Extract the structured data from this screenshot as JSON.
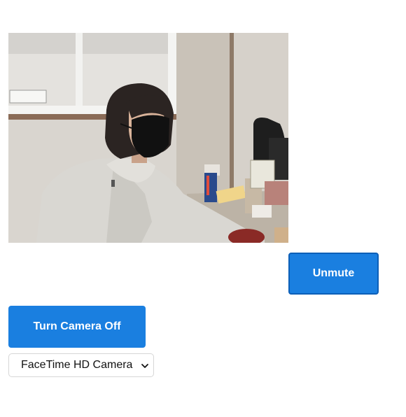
{
  "video": {
    "icon": "camera-feed-image",
    "description_colors": {
      "wall": "#cfcac2",
      "hoodie": "#d9d7d2",
      "hair": "#2b2422",
      "mask": "#111111"
    }
  },
  "controls": {
    "unmute_label": "Unmute",
    "camera_toggle_label": "Turn Camera Off",
    "camera_select": {
      "selected": "FaceTime HD Camera"
    }
  },
  "theme": {
    "button_bg": "#1a7fe0",
    "button_border": "#0d5fb7",
    "button_text": "#ffffff"
  }
}
